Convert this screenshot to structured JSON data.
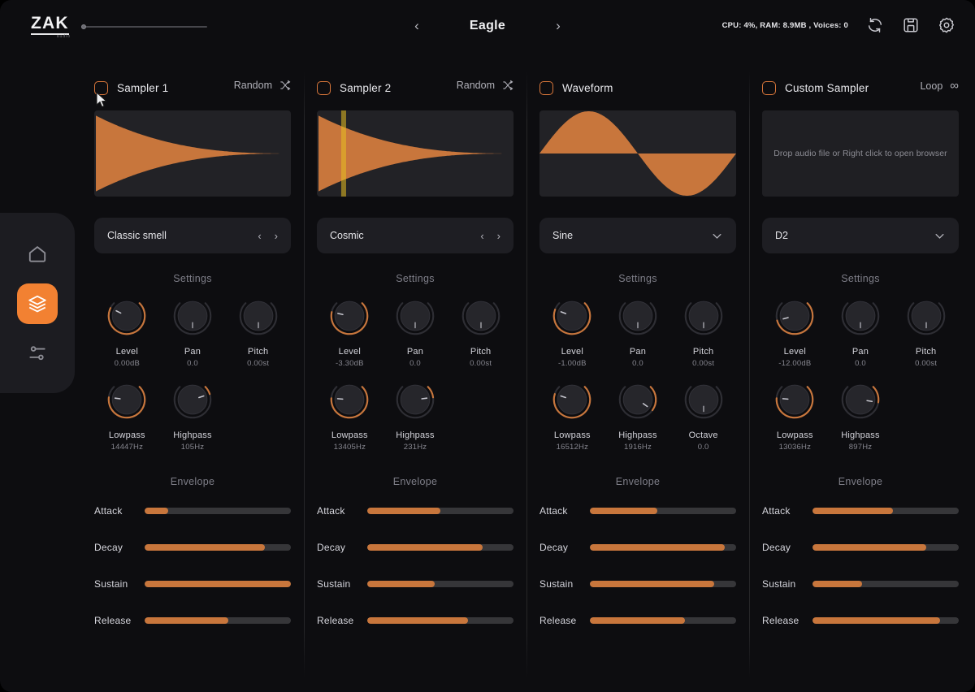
{
  "header": {
    "logo": "ZAK",
    "logo_sub": "audio",
    "preset_name": "Eagle",
    "prev_label": "‹",
    "next_label": "›",
    "stats": "CPU: 4%, RAM: 8.9MB , Voices: 0",
    "master_value": 0,
    "icons": {
      "refresh": "refresh-icon",
      "save": "save-icon",
      "settings": "gear-icon"
    }
  },
  "sidebar": {
    "items": [
      {
        "name": "home",
        "label": "Home",
        "active": false
      },
      {
        "name": "layers",
        "label": "Layers",
        "active": true
      },
      {
        "name": "mixer",
        "label": "Mixer",
        "active": false
      }
    ]
  },
  "accent": "#c8763c",
  "accent_bright": "#f28132",
  "panels": [
    {
      "id": "sampler-1",
      "title": "Sampler 1",
      "enabled": false,
      "head_action": {
        "label": "Random",
        "icon": "shuffle-icon"
      },
      "display": {
        "type": "waveform-decay",
        "playhead": null
      },
      "selector": {
        "value": "Classic smell",
        "control": "arrows"
      },
      "settings_title": "Settings",
      "knobs_row1": [
        {
          "name": "Level",
          "value": "0.00dB",
          "arc": 0.93,
          "pointer": 0.93
        },
        {
          "name": "Pan",
          "value": "0.0",
          "arc": 0.0,
          "pointer": 0.5
        },
        {
          "name": "Pitch",
          "value": "0.00st",
          "arc": 0.0,
          "pointer": 0.5
        }
      ],
      "knobs_row2": [
        {
          "name": "Lowpass",
          "value": "14447Hz",
          "arc": 0.86,
          "pointer": 0.86
        },
        {
          "name": "Highpass",
          "value": "105Hz",
          "arc": 0.1,
          "pointer": 0.1
        }
      ],
      "envelope_title": "Envelope",
      "envelope": [
        {
          "name": "Attack",
          "value": 0.16
        },
        {
          "name": "Decay",
          "value": 0.82
        },
        {
          "name": "Sustain",
          "value": 1.0
        },
        {
          "name": "Release",
          "value": 0.57
        }
      ]
    },
    {
      "id": "sampler-2",
      "title": "Sampler 2",
      "enabled": false,
      "head_action": {
        "label": "Random",
        "icon": "shuffle-icon"
      },
      "display": {
        "type": "waveform-decay",
        "playhead": 0.13
      },
      "selector": {
        "value": "Cosmic",
        "control": "arrows"
      },
      "settings_title": "Settings",
      "knobs_row1": [
        {
          "name": "Level",
          "value": "-3.30dB",
          "arc": 0.88,
          "pointer": 0.88
        },
        {
          "name": "Pan",
          "value": "0.0",
          "arc": 0.0,
          "pointer": 0.5
        },
        {
          "name": "Pitch",
          "value": "0.00st",
          "arc": 0.0,
          "pointer": 0.5
        }
      ],
      "knobs_row2": [
        {
          "name": "Lowpass",
          "value": "13405Hz",
          "arc": 0.85,
          "pointer": 0.85
        },
        {
          "name": "Highpass",
          "value": "231Hz",
          "arc": 0.14,
          "pointer": 0.14
        }
      ],
      "envelope_title": "Envelope",
      "envelope": [
        {
          "name": "Attack",
          "value": 0.5
        },
        {
          "name": "Decay",
          "value": 0.79
        },
        {
          "name": "Sustain",
          "value": 0.46
        },
        {
          "name": "Release",
          "value": 0.69
        }
      ]
    },
    {
      "id": "waveform",
      "title": "Waveform",
      "enabled": false,
      "head_action": null,
      "display": {
        "type": "sine",
        "playhead": null
      },
      "selector": {
        "value": "Sine",
        "control": "chevron"
      },
      "settings_title": "Settings",
      "knobs_row1": [
        {
          "name": "Level",
          "value": "-1.00dB",
          "arc": 0.91,
          "pointer": 0.91
        },
        {
          "name": "Pan",
          "value": "0.0",
          "arc": 0.0,
          "pointer": 0.5
        },
        {
          "name": "Pitch",
          "value": "0.00st",
          "arc": 0.0,
          "pointer": 0.5
        }
      ],
      "knobs_row2": [
        {
          "name": "Lowpass",
          "value": "16512Hz",
          "arc": 0.9,
          "pointer": 0.9
        },
        {
          "name": "Highpass",
          "value": "1916Hz",
          "arc": 0.3,
          "pointer": 0.3
        },
        {
          "name": "Octave",
          "value": "0.0",
          "arc": 0.0,
          "pointer": 0.5
        }
      ],
      "envelope_title": "Envelope",
      "envelope": [
        {
          "name": "Attack",
          "value": 0.46
        },
        {
          "name": "Decay",
          "value": 0.92
        },
        {
          "name": "Sustain",
          "value": 0.85
        },
        {
          "name": "Release",
          "value": 0.65
        }
      ]
    },
    {
      "id": "custom-sampler",
      "title": "Custom Sampler",
      "enabled": false,
      "head_action": {
        "label": "Loop",
        "icon": "infinity-icon"
      },
      "display": {
        "type": "empty",
        "placeholder": "Drop audio file or Right click to open browser"
      },
      "selector": {
        "value": "D2",
        "control": "chevron"
      },
      "settings_title": "Settings",
      "knobs_row1": [
        {
          "name": "Level",
          "value": "-12.00dB",
          "arc": 0.78,
          "pointer": 0.78
        },
        {
          "name": "Pan",
          "value": "0.0",
          "arc": 0.0,
          "pointer": 0.5
        },
        {
          "name": "Pitch",
          "value": "0.00st",
          "arc": 0.0,
          "pointer": 0.5
        }
      ],
      "knobs_row2": [
        {
          "name": "Lowpass",
          "value": "13036Hz",
          "arc": 0.85,
          "pointer": 0.85
        },
        {
          "name": "Highpass",
          "value": "897Hz",
          "arc": 0.2,
          "pointer": 0.2
        }
      ],
      "envelope_title": "Envelope",
      "envelope": [
        {
          "name": "Attack",
          "value": 0.55
        },
        {
          "name": "Decay",
          "value": 0.78
        },
        {
          "name": "Sustain",
          "value": 0.34
        },
        {
          "name": "Release",
          "value": 0.87
        }
      ]
    }
  ]
}
